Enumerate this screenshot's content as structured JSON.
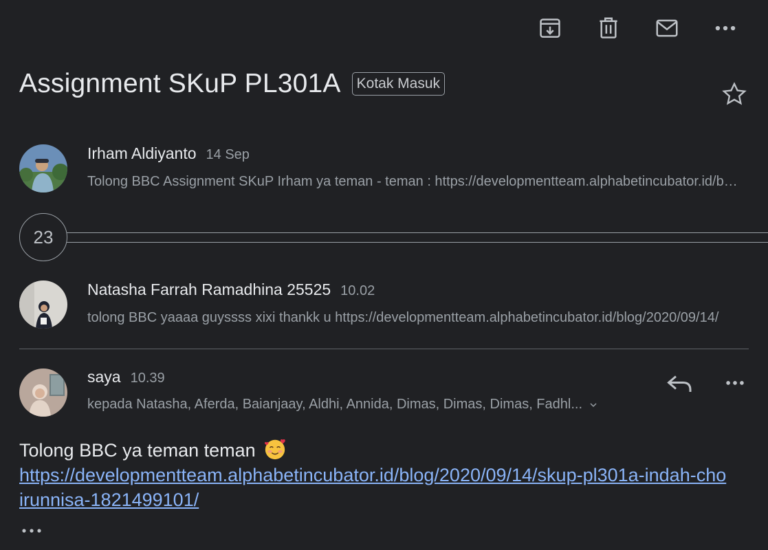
{
  "toolbar": {
    "archive_icon": "archive-icon",
    "delete_icon": "trash-icon",
    "mark_unread_icon": "mail-icon",
    "more_icon": "more-horizontal-icon"
  },
  "thread": {
    "subject": "Assignment SKuP PL301A",
    "label": "Kotak Masuk"
  },
  "messages": [
    {
      "sender": "Irham Aldiyanto",
      "time": "14 Sep",
      "snippet": "Tolong BBC Assignment SKuP Irham ya teman - teman : https://developmentteam.alphabetincubator.id/blog/2020/09/14/"
    },
    {
      "collapsed_count": "23"
    },
    {
      "sender": "Natasha Farrah Ramadhina 25525",
      "time": "10.02",
      "snippet": "tolong BBC yaaaa guyssss xixi thankk u https://developmentteam.alphabetincubator.id/blog/2020/09/14/"
    },
    {
      "sender": "saya",
      "time": "10.39",
      "recipients": "kepada Natasha, Aferda, Baianjaay, Aldhi, Annida, Dimas, Dimas, Dimas, Fadhl...",
      "body_text": "Tolong BBC ya teman teman",
      "body_link": "https://developmentteam.alphabetincubator.id/blog/2020/09/14/skup-pl301a-indah-choirunnisa-1821499101/"
    }
  ],
  "colors": {
    "background": "#202124",
    "link": "#8ab4f8",
    "secondary_text": "#9aa0a6"
  }
}
